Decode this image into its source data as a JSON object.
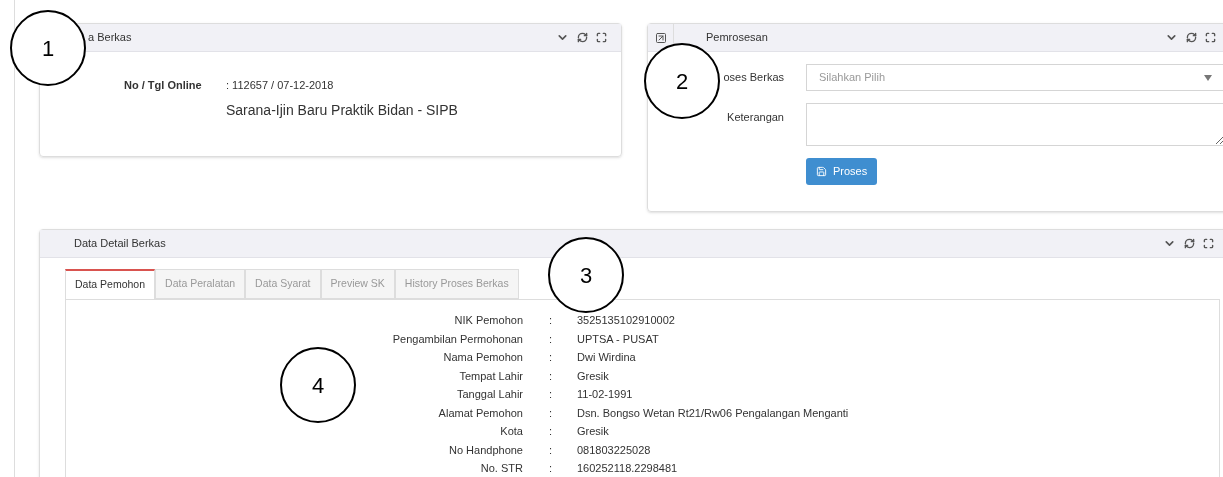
{
  "info_panel": {
    "title": "a Berkas",
    "label": "No / Tgl Online",
    "value": ": 112657 / 07-12-2018",
    "subtitle": "Sarana-Ijin Baru Praktik Bidan - SIPB"
  },
  "process_panel": {
    "title": "Pemrosesan",
    "select_label": "oses Berkas",
    "select_placeholder": "Silahkan Pilih",
    "textarea_label": "Keterangan",
    "button": "Proses"
  },
  "detail_panel": {
    "title": "Data Detail Berkas",
    "tabs": [
      {
        "label": "Data Pemohon",
        "selected": true
      },
      {
        "label": "Data Peralatan",
        "selected": false
      },
      {
        "label": "Data Syarat",
        "selected": false
      },
      {
        "label": "Preview SK",
        "selected": false
      },
      {
        "label": "History Proses Berkas",
        "selected": false
      }
    ],
    "rows": [
      {
        "label": "NIK Pemohon",
        "separator": ":",
        "value": "3525135102910002"
      },
      {
        "label": "Pengambilan Permohonan",
        "separator": ":",
        "value": "UPTSA - PUSAT"
      },
      {
        "label": "Nama Pemohon",
        "separator": ":",
        "value": "Dwi Wirdina"
      },
      {
        "label": "Tempat Lahir",
        "separator": ":",
        "value": "Gresik"
      },
      {
        "label": "Tanggal Lahir",
        "separator": ":",
        "value": "11-02-1991"
      },
      {
        "label": "Alamat Pemohon",
        "separator": ":",
        "value": "Dsn. Bongso Wetan Rt21/Rw06 Pengalangan Menganti"
      },
      {
        "label": "Kota",
        "separator": ":",
        "value": "Gresik"
      },
      {
        "label": "No Handphone",
        "separator": ":",
        "value": "081803225028"
      },
      {
        "label": "No. STR",
        "separator": ":",
        "value": "160252118.2298481"
      }
    ]
  },
  "annotations": [
    {
      "label": "1"
    },
    {
      "label": "2"
    },
    {
      "label": "3"
    },
    {
      "label": "4"
    }
  ]
}
